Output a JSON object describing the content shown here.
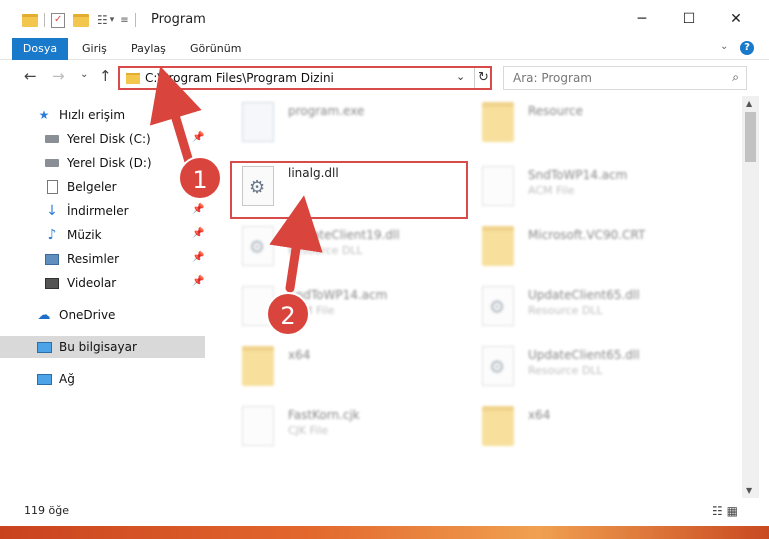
{
  "window": {
    "title": "Program",
    "minimize": "─",
    "maximize": "☐",
    "close": "✕"
  },
  "ribbon": {
    "tabs": [
      "Dosya",
      "Giriş",
      "Paylaş",
      "Görünüm"
    ]
  },
  "nav": {
    "back": "←",
    "forward": "→",
    "recent": "⌄",
    "up": "↑",
    "path": "C:\\Program Files\\Program Dizini",
    "dropdown": "⌄",
    "refresh": "↻",
    "search_placeholder": "Ara: Program",
    "help": "?",
    "expand": "⌄"
  },
  "sidebar": {
    "items": [
      {
        "label": "Hızlı erişim",
        "icon": "star-icon"
      },
      {
        "label": "Yerel Disk (C:)",
        "icon": "disk-icon"
      },
      {
        "label": "Yerel Disk (D:)",
        "icon": "disk-icon"
      },
      {
        "label": "Belgeler",
        "icon": "documents-icon"
      },
      {
        "label": "İndirmeler",
        "icon": "download-icon"
      },
      {
        "label": "Müzik",
        "icon": "music-icon"
      },
      {
        "label": "Resimler",
        "icon": "pictures-icon"
      },
      {
        "label": "Videolar",
        "icon": "video-icon"
      },
      {
        "label": "OneDrive",
        "icon": "cloud-icon"
      },
      {
        "label": "Bu bilgisayar",
        "icon": "computer-icon"
      },
      {
        "label": "Ağ",
        "icon": "network-icon"
      }
    ]
  },
  "files": [
    {
      "name": "program.exe",
      "sub": ""
    },
    {
      "name": "Resource",
      "sub": ""
    },
    {
      "name": "linalg.dll",
      "sub": ""
    },
    {
      "name": "SndToWP14.acm",
      "sub": "ACM File"
    },
    {
      "name": "UpdateClient19.dll",
      "sub": "Resource DLL"
    },
    {
      "name": "Microsoft.VC90.CRT",
      "sub": ""
    },
    {
      "name": "SndToWP14.acm",
      "sub": "ACM File"
    },
    {
      "name": "UpdateClient65.dll",
      "sub": "Resource DLL"
    },
    {
      "name": "x64",
      "sub": ""
    },
    {
      "name": "UpdateClient65.dll",
      "sub": "Resource DLL"
    },
    {
      "name": "FastKorn.cjk",
      "sub": "CJK File"
    },
    {
      "name": "x64",
      "sub": ""
    }
  ],
  "status": {
    "count": "119 öğe"
  },
  "annotations": {
    "step1": "1",
    "step2": "2"
  },
  "colors": {
    "accent": "#1979ca",
    "highlight": "#d94b4b",
    "badge": "#d9453d"
  }
}
